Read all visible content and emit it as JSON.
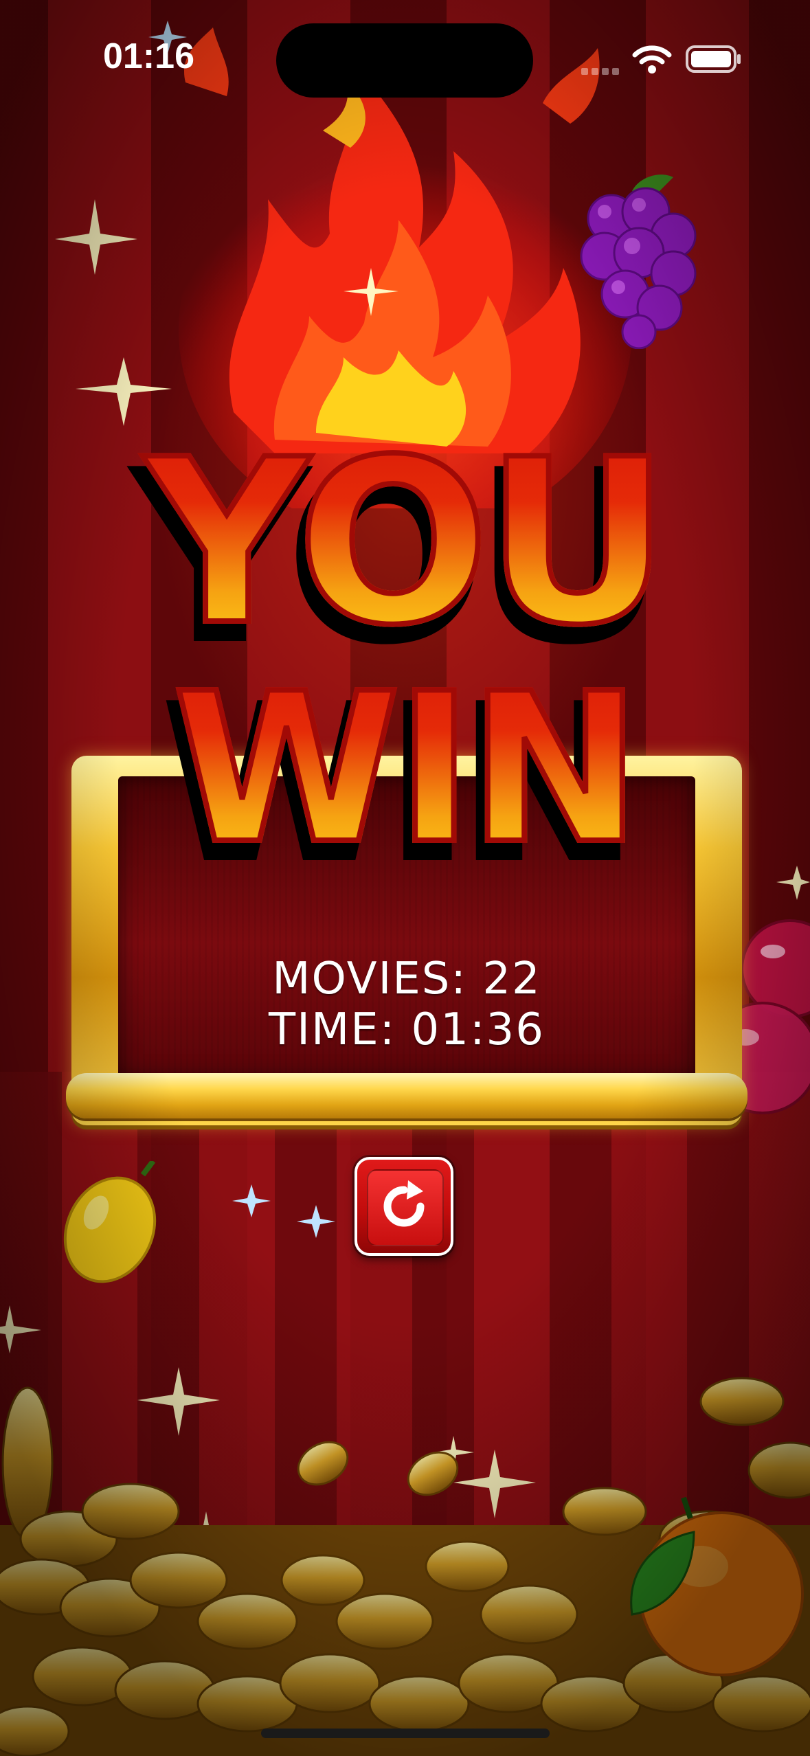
{
  "status_bar": {
    "time": "01:16",
    "wifi_icon": "wifi-icon",
    "battery_icon": "battery-icon"
  },
  "banner": {
    "line1": "YOU",
    "line2": "WIN"
  },
  "results": {
    "movies_line": "MOVIES: 22",
    "time_line": "TIME: 01:36"
  },
  "restart_button": {
    "icon": "restart-icon"
  },
  "decorations": {
    "fire": "fire-icon",
    "fruits": [
      "grapes-icon",
      "cherry-icon",
      "lemon-icon",
      "orange-icon"
    ],
    "coins": "coin-pile",
    "sparkles": "sparkle-icon"
  },
  "colors": {
    "background": "#8c0e12",
    "title_top": "#d81808",
    "title_bottom": "#ffe21c",
    "frame_gold": "#f7c634",
    "button_red": "#c20c0c"
  }
}
